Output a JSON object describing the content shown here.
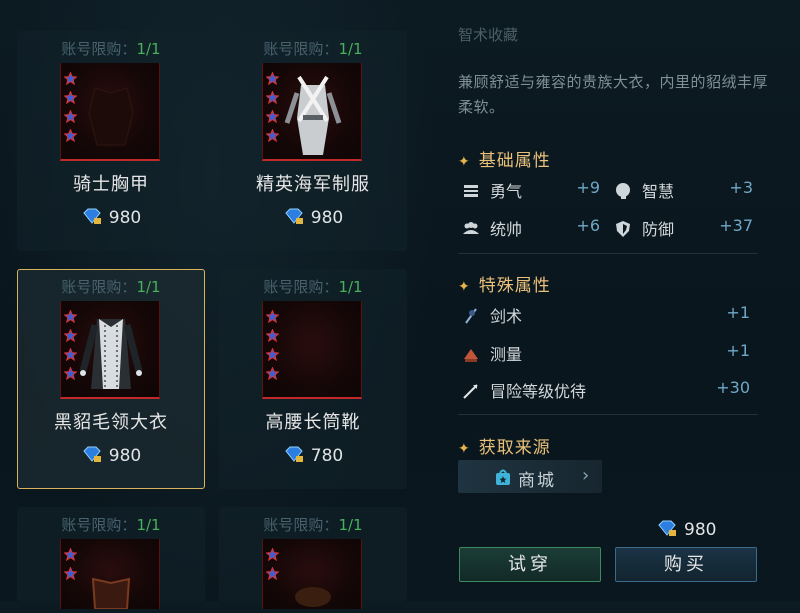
{
  "header": {
    "subtitle": "智术收藏"
  },
  "items": [
    {
      "limit_label": "账号限购：",
      "limit_count": "1/1",
      "name": "骑士胸甲",
      "price": "980"
    },
    {
      "limit_label": "账号限购：",
      "limit_count": "1/1",
      "name": "精英海军制服",
      "price": "980"
    },
    {
      "limit_label": "账号限购：",
      "limit_count": "1/1",
      "name": "黑貂毛领大衣",
      "price": "980"
    },
    {
      "limit_label": "账号限购：",
      "limit_count": "1/1",
      "name": "高腰长筒靴",
      "price": "780"
    },
    {
      "limit_label": "账号限购：",
      "limit_count": "1/1"
    },
    {
      "limit_label": "账号限购：",
      "limit_count": "1/1"
    }
  ],
  "detail": {
    "description": "兼顾舒适与雍容的贵族大衣，内里的貂绒丰厚柔软。",
    "basic_title": "基础属性",
    "basic": [
      {
        "name": "勇气",
        "value": "+9"
      },
      {
        "name": "智慧",
        "value": "+3"
      },
      {
        "name": "统帅",
        "value": "+6"
      },
      {
        "name": "防御",
        "value": "+37"
      }
    ],
    "special_title": "特殊属性",
    "special": [
      {
        "name": "剑术",
        "value": "+1"
      },
      {
        "name": "测量",
        "value": "+1"
      },
      {
        "name": "冒险等级优待",
        "value": "+30"
      }
    ],
    "source_title": "获取来源",
    "source_button": "商城",
    "price": "980",
    "try_button": "试穿",
    "buy_button": "购买"
  },
  "colors": {
    "accent_gold": "#e8c07a",
    "selected_border": "#d9b35c",
    "limit_green": "#49b05b",
    "value_blue": "#6fa8c7"
  }
}
